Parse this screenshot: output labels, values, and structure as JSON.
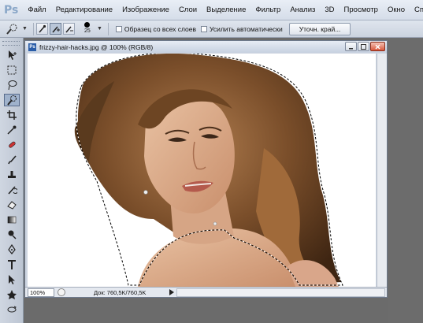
{
  "app": {
    "logo": "Ps",
    "menu": [
      "Файл",
      "Редактирование",
      "Изображение",
      "Слои",
      "Выделение",
      "Фильтр",
      "Анализ",
      "3D",
      "Просмотр",
      "Окно",
      "Справка"
    ]
  },
  "options": {
    "tool_icon": "quick-selection-icon",
    "brush_size": "25",
    "sample_all_layers_label": "Образец со всех слоев",
    "auto_enhance_label": "Усилить автоматически",
    "refine_edge_label": "Уточн. край..."
  },
  "tools": [
    "move-icon",
    "marquee-icon",
    "lasso-icon",
    "quick-selection-icon",
    "crop-icon",
    "eyedropper-icon",
    "healing-brush-icon",
    "brush-icon",
    "clone-stamp-icon",
    "history-brush-icon",
    "eraser-icon",
    "gradient-icon",
    "dodge-icon",
    "pen-icon",
    "type-icon",
    "path-selection-icon",
    "shape-icon",
    "3d-rotate-icon",
    "3d-orbit-icon",
    "hand-icon"
  ],
  "document": {
    "title": "frizzy-hair-hacks.jpg @ 100% (RGB/8)",
    "zoom": "100%",
    "doc_info": "Док: 760,5K/760,5K"
  },
  "colors": {
    "accent": "#2a5da8",
    "app_background": "#6b6b6b",
    "canvas": "#ffffff"
  }
}
